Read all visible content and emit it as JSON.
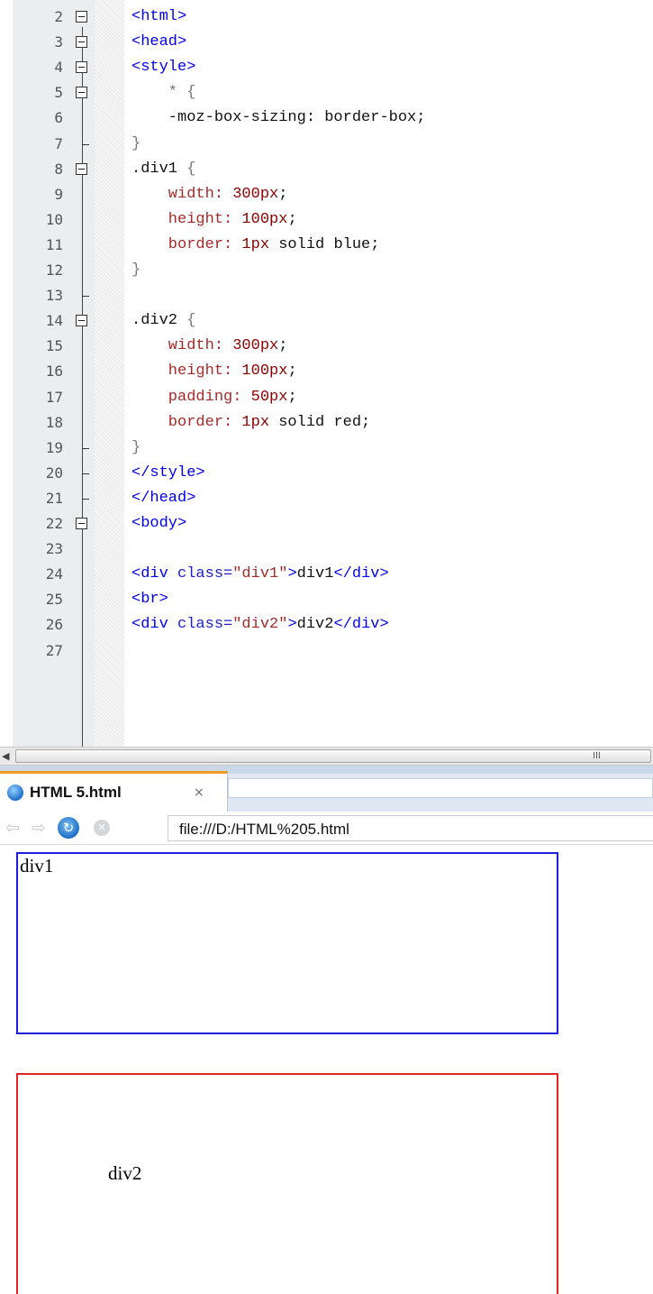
{
  "editor": {
    "lines": [
      {
        "num": "2",
        "fold": "box",
        "tokens": [
          {
            "t": "<html>",
            "c": "c-tag"
          }
        ]
      },
      {
        "num": "3",
        "fold": "box",
        "tokens": [
          {
            "t": "<head>",
            "c": "c-tag"
          }
        ]
      },
      {
        "num": "4",
        "fold": "box",
        "tokens": [
          {
            "t": "<style>",
            "c": "c-tag"
          }
        ]
      },
      {
        "num": "5",
        "fold": "box",
        "tokens": [
          {
            "t": "    * {",
            "c": "c-brace"
          }
        ]
      },
      {
        "num": "6",
        "fold": "",
        "tokens": [
          {
            "t": "    -moz-box-sizing: border-box;",
            "c": "c-val"
          }
        ]
      },
      {
        "num": "7",
        "fold": "end",
        "tokens": [
          {
            "t": "}",
            "c": "c-brace"
          }
        ]
      },
      {
        "num": "8",
        "fold": "box",
        "tokens": [
          {
            "t": ".div1 ",
            "c": "c-sel"
          },
          {
            "t": "{",
            "c": "c-brace"
          }
        ]
      },
      {
        "num": "9",
        "fold": "",
        "tokens": [
          {
            "t": "    width: ",
            "c": "c-prop"
          },
          {
            "t": "300px",
            "c": "c-num"
          },
          {
            "t": ";",
            "c": "c-val"
          }
        ]
      },
      {
        "num": "10",
        "fold": "",
        "tokens": [
          {
            "t": "    height: ",
            "c": "c-prop"
          },
          {
            "t": "100px",
            "c": "c-num"
          },
          {
            "t": ";",
            "c": "c-val"
          }
        ]
      },
      {
        "num": "11",
        "fold": "",
        "tokens": [
          {
            "t": "    border: ",
            "c": "c-prop"
          },
          {
            "t": "1px",
            "c": "c-num"
          },
          {
            "t": " solid blue;",
            "c": "c-val"
          }
        ]
      },
      {
        "num": "12",
        "fold": "",
        "tokens": [
          {
            "t": "}",
            "c": "c-brace"
          }
        ]
      },
      {
        "num": "13",
        "fold": "end",
        "tokens": []
      },
      {
        "num": "14",
        "fold": "box",
        "tokens": [
          {
            "t": ".div2 ",
            "c": "c-sel"
          },
          {
            "t": "{",
            "c": "c-brace"
          }
        ]
      },
      {
        "num": "15",
        "fold": "",
        "tokens": [
          {
            "t": "    width: ",
            "c": "c-prop"
          },
          {
            "t": "300px",
            "c": "c-num"
          },
          {
            "t": ";",
            "c": "c-val"
          }
        ]
      },
      {
        "num": "16",
        "fold": "",
        "tokens": [
          {
            "t": "    height: ",
            "c": "c-prop"
          },
          {
            "t": "100px",
            "c": "c-num"
          },
          {
            "t": ";",
            "c": "c-val"
          }
        ]
      },
      {
        "num": "17",
        "fold": "",
        "tokens": [
          {
            "t": "    padding: ",
            "c": "c-prop"
          },
          {
            "t": "50px",
            "c": "c-num"
          },
          {
            "t": ";",
            "c": "c-val"
          }
        ]
      },
      {
        "num": "18",
        "fold": "",
        "tokens": [
          {
            "t": "    border: ",
            "c": "c-prop"
          },
          {
            "t": "1px",
            "c": "c-num"
          },
          {
            "t": " solid red;",
            "c": "c-val"
          }
        ]
      },
      {
        "num": "19",
        "fold": "end",
        "tokens": [
          {
            "t": "}",
            "c": "c-brace"
          }
        ]
      },
      {
        "num": "20",
        "fold": "end",
        "tokens": [
          {
            "t": "</style>",
            "c": "c-tag"
          }
        ]
      },
      {
        "num": "21",
        "fold": "end",
        "tokens": [
          {
            "t": "</head>",
            "c": "c-tag"
          }
        ]
      },
      {
        "num": "22",
        "fold": "box",
        "tokens": [
          {
            "t": "<body>",
            "c": "c-tag"
          }
        ]
      },
      {
        "num": "23",
        "fold": "",
        "tokens": []
      },
      {
        "num": "24",
        "fold": "",
        "tokens": [
          {
            "t": "<div ",
            "c": "c-tag"
          },
          {
            "t": "class=",
            "c": "c-attr"
          },
          {
            "t": "\"div1\"",
            "c": "c-str"
          },
          {
            "t": ">",
            "c": "c-tag"
          },
          {
            "t": "div1",
            "c": "c-text"
          },
          {
            "t": "</div>",
            "c": "c-tag"
          }
        ]
      },
      {
        "num": "25",
        "fold": "",
        "tokens": [
          {
            "t": "<br>",
            "c": "c-tag"
          }
        ]
      },
      {
        "num": "26",
        "fold": "",
        "tokens": [
          {
            "t": "<div ",
            "c": "c-tag"
          },
          {
            "t": "class=",
            "c": "c-attr"
          },
          {
            "t": "\"div2\"",
            "c": "c-str"
          },
          {
            "t": ">",
            "c": "c-tag"
          },
          {
            "t": "div2",
            "c": "c-text"
          },
          {
            "t": "</div>",
            "c": "c-tag"
          }
        ]
      },
      {
        "num": "27",
        "fold": "",
        "tokens": []
      }
    ],
    "scrollbar": {
      "left_arrow_icon": "chevron-left-icon",
      "grip": "III"
    }
  },
  "browser": {
    "tab": {
      "title": "HTML 5.html",
      "close": "×",
      "icon": "page-globe-icon"
    },
    "nav": {
      "back_icon": "back-arrow-icon",
      "forward_icon": "forward-arrow-icon",
      "reload_icon": "reload-icon",
      "stop_icon": "stop-icon"
    },
    "address": "file:///D:/HTML%205.html",
    "content": {
      "div1_text": "div1",
      "div2_text": "div2"
    },
    "colors": {
      "div1_border": "#1e1ed8",
      "div2_border": "#e02424",
      "tab_accent": "#f09a1f"
    }
  }
}
